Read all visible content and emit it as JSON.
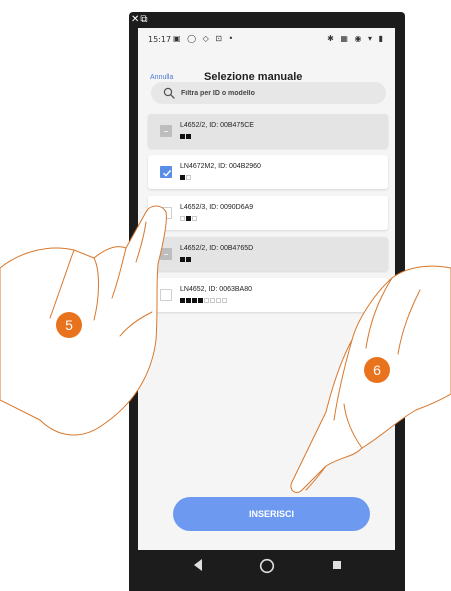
{
  "status_bar": {
    "time": "15:17"
  },
  "header": {
    "cancel_label": "Annulla",
    "title": "Selezione manuale"
  },
  "search": {
    "placeholder": "Filtra per ID o modello",
    "icon": "search-icon"
  },
  "devices": [
    {
      "label": "L4652/2, ID: 00B475CE",
      "state": "disabled",
      "indicator": [
        1,
        1
      ]
    },
    {
      "label": "LN4672M2, ID: 004B2960",
      "state": "checked",
      "indicator": [
        1,
        0
      ]
    },
    {
      "label": "L4652/3, ID: 0090D6A9",
      "state": "unchecked",
      "indicator": [
        0,
        1,
        0
      ]
    },
    {
      "label": "L4652/2, ID: 00B4765D",
      "state": "disabled",
      "indicator": [
        1,
        1
      ]
    },
    {
      "label": "LN4652, ID: 0063BA80",
      "state": "unchecked",
      "indicator": [
        1,
        1,
        1,
        1,
        0,
        0,
        0,
        0
      ]
    }
  ],
  "insert_button": {
    "label": "INSERISCI"
  },
  "nav_bar": {
    "icons": [
      "back-triangle-icon",
      "home-circle-icon",
      "recents-square-icon"
    ]
  },
  "steps": {
    "step_a": "5",
    "step_b": "6"
  },
  "colors": {
    "accent": "#6d9af0",
    "step_badge": "#e8731c",
    "checkbox_checked": "#5a8de6"
  }
}
